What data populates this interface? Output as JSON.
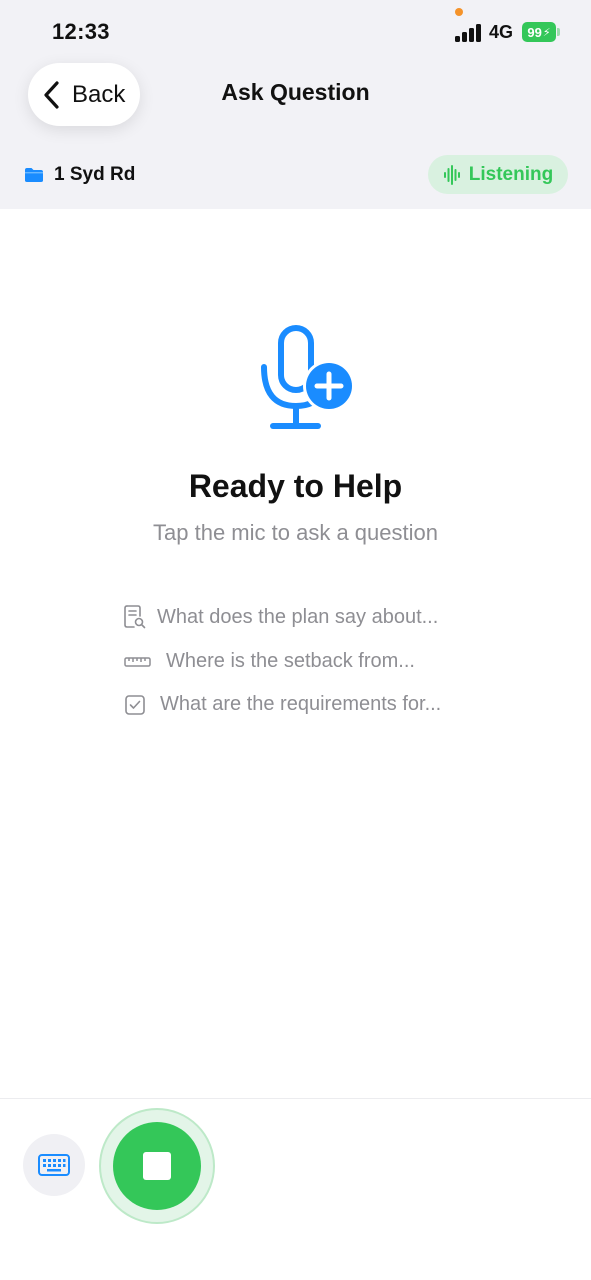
{
  "status_bar": {
    "time": "12:33",
    "network": "4G",
    "battery": "99"
  },
  "nav": {
    "back_label": "Back",
    "title": "Ask Question"
  },
  "project": {
    "name": "1 Syd Rd",
    "icon": "folder-icon"
  },
  "listening_badge": {
    "label": "Listening",
    "icon": "waveform-icon"
  },
  "hero": {
    "icon": "mic-plus-icon",
    "title": "Ready to Help",
    "subtitle": "Tap the mic to ask a question"
  },
  "suggestions": [
    {
      "icon": "document-search-icon",
      "text": "What does the plan say about..."
    },
    {
      "icon": "ruler-icon",
      "text": "Where is the setback from..."
    },
    {
      "icon": "checkbox-icon",
      "text": "What are the requirements for..."
    }
  ],
  "bottom_bar": {
    "keyboard_icon": "keyboard-icon",
    "stop_icon": "stop-icon"
  },
  "colors": {
    "accent_blue": "#1a8cff",
    "accent_green": "#34c759",
    "header_bg": "#f2f2f6",
    "muted_text": "#8e8e93"
  }
}
